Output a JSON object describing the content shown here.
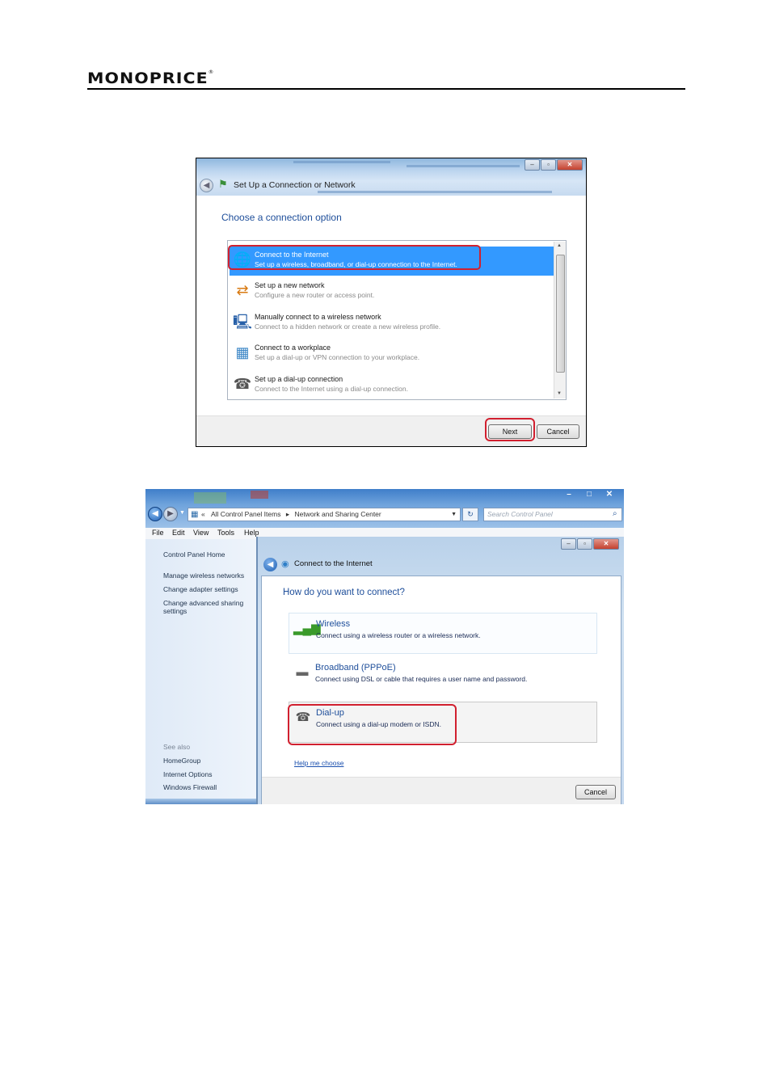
{
  "header": {
    "brand": "MONOPRICE",
    "reg_mark": "®"
  },
  "shot1": {
    "window_title": "Set Up a Connection or Network",
    "heading": "Choose a connection option",
    "items": [
      {
        "title": "Connect to the Internet",
        "desc": "Set up a wireless, broadband, or dial-up connection to the Internet.",
        "icon": "globe-icon",
        "selected": true
      },
      {
        "title": "Set up a new network",
        "desc": "Configure a new router or access point.",
        "icon": "router-icon",
        "selected": false
      },
      {
        "title": "Manually connect to a wireless network",
        "desc": "Connect to a hidden network or create a new wireless profile.",
        "icon": "wireless-computer-icon",
        "selected": false
      },
      {
        "title": "Connect to a workplace",
        "desc": "Set up a dial-up or VPN connection to your workplace.",
        "icon": "workplace-icon",
        "selected": false
      },
      {
        "title": "Set up a dial-up connection",
        "desc": "Connect to the Internet using a dial-up connection.",
        "icon": "phone-icon",
        "selected": false
      }
    ],
    "next_label": "Next",
    "cancel_label": "Cancel",
    "highlight_color": "#d1202f",
    "selection_color": "#3399ff"
  },
  "shot2": {
    "address": {
      "prefix": "«",
      "crumb1": "All Control Panel Items",
      "sep": "▸",
      "crumb2": "Network and Sharing Center"
    },
    "search_placeholder": "Search Control Panel",
    "menu": [
      "File",
      "Edit",
      "View",
      "Tools",
      "Help"
    ],
    "sidebar": {
      "home": "Control Panel Home",
      "links": [
        "Manage wireless networks",
        "Change adapter settings",
        "Change advanced sharing settings"
      ],
      "see_also": "See also",
      "see_also_links": [
        "HomeGroup",
        "Internet Options",
        "Windows Firewall"
      ]
    },
    "dialog_title": "Connect to the Internet",
    "heading": "How do you want to connect?",
    "options": [
      {
        "title": "Wireless",
        "desc": "Connect using a wireless router or a wireless network.",
        "icon": "signal-bars-icon"
      },
      {
        "title": "Broadband (PPPoE)",
        "desc": "Connect using DSL or cable that requires a user name and password.",
        "icon": "modem-icon"
      },
      {
        "title": "Dial-up",
        "desc": "Connect using a dial-up modem or ISDN.",
        "icon": "dialup-modem-icon"
      }
    ],
    "help_link": "Help me choose",
    "cancel_label": "Cancel"
  }
}
